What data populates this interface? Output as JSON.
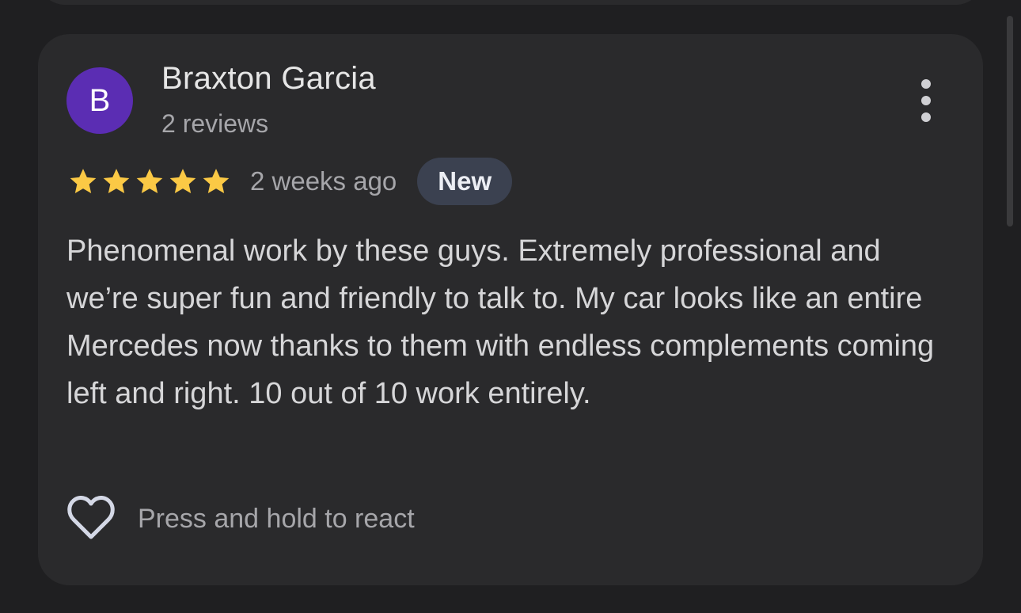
{
  "review": {
    "author": {
      "initial": "B",
      "name": "Braxton Garcia",
      "review_count": "2 reviews",
      "avatar_color": "#5b2db3"
    },
    "rating": {
      "stars": 5,
      "max_stars": 5,
      "star_color": "#fbc945"
    },
    "date": "2 weeks ago",
    "badge": "New",
    "text": "Phenomenal work by these guys. Extremely professional and we’re super fun and friendly to talk to. My car looks like an entire Mercedes now thanks to them with endless complements coming left and right. 10 out of 10 work entirely.",
    "react_hint": "Press and hold to react",
    "icons": {
      "more": "more-vertical-icon",
      "react": "heart-outline-icon",
      "star": "star-filled-icon"
    }
  }
}
